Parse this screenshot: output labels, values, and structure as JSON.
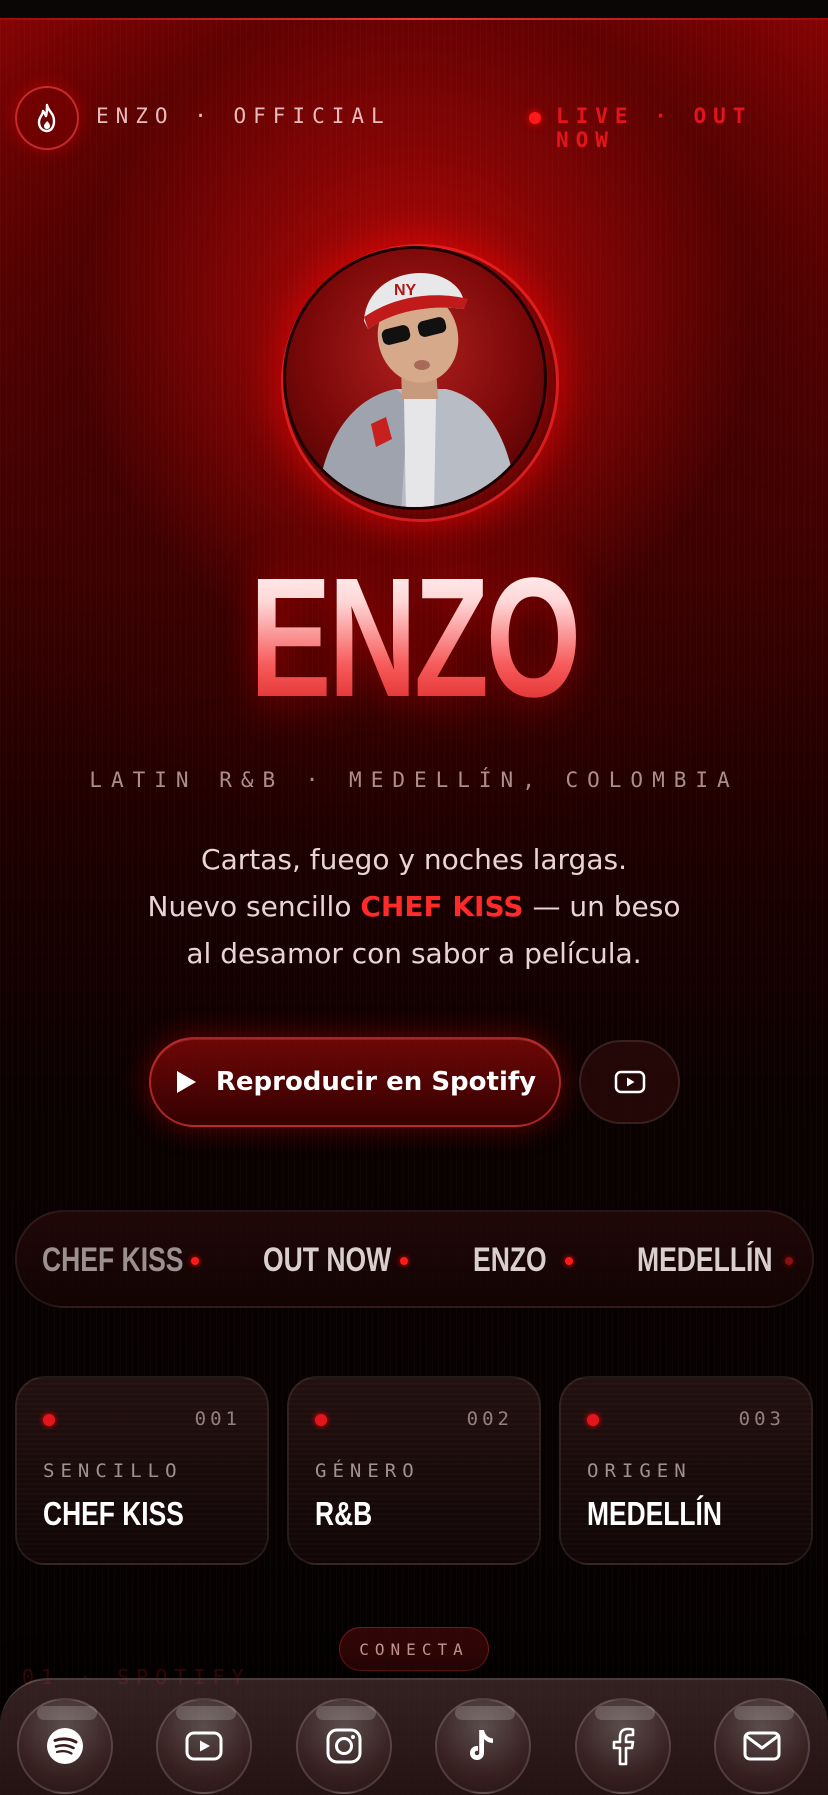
{
  "header": {
    "brand": "ENZO · OFFICIAL",
    "live_status": "LIVE · OUT NOW"
  },
  "hero": {
    "name": "ENZO",
    "subtitle": "LATIN R&B · MEDELLÍN, COLOMBIA",
    "tagline": {
      "line1": "Cartas, fuego y noches largas.",
      "line2_before": "Nuevo sencillo ",
      "line2_highlight": "CHEF KISS",
      "line2_after": " — un beso",
      "line3": "al desamor con sabor a película."
    }
  },
  "actions": {
    "spotify_label": "Reproducir en Spotify",
    "youtube_icon": "youtube-play-icon"
  },
  "marquee": {
    "items": [
      "CHEF KISS",
      "OUT NOW",
      "ENZO",
      "MEDELLÍN"
    ]
  },
  "cards": [
    {
      "num": "001",
      "key": "SENCILLO",
      "value": "CHEF KISS"
    },
    {
      "num": "002",
      "key": "GÉNERO",
      "value": "R&B"
    },
    {
      "num": "003",
      "key": "ORIGEN",
      "value": "MEDELLÍN"
    }
  ],
  "connect": {
    "label": "CONECTA",
    "first_link_partial": "01 · SPOTIFY"
  },
  "dock": {
    "icons": [
      "spotify-icon",
      "youtube-icon",
      "instagram-icon",
      "tiktok-icon",
      "facebook-icon",
      "mail-icon"
    ]
  },
  "colors": {
    "accent": "#e3151a",
    "background": "#050101",
    "hero_red": "#b80808"
  }
}
